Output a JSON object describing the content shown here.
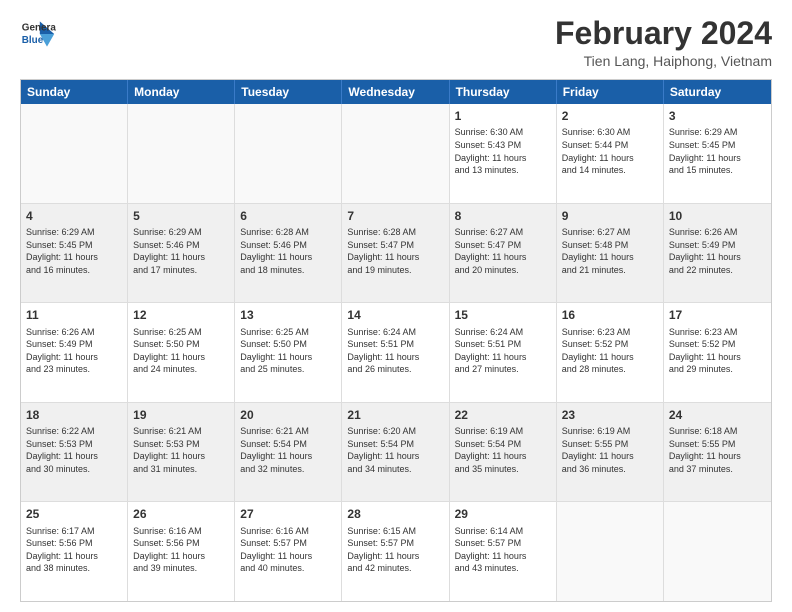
{
  "header": {
    "logo_line1": "General",
    "logo_line2": "Blue",
    "main_title": "February 2024",
    "subtitle": "Tien Lang, Haiphong, Vietnam"
  },
  "calendar": {
    "days": [
      "Sunday",
      "Monday",
      "Tuesday",
      "Wednesday",
      "Thursday",
      "Friday",
      "Saturday"
    ],
    "rows": [
      [
        {
          "day": "",
          "info": ""
        },
        {
          "day": "",
          "info": ""
        },
        {
          "day": "",
          "info": ""
        },
        {
          "day": "",
          "info": ""
        },
        {
          "day": "1",
          "info": "Sunrise: 6:30 AM\nSunset: 5:43 PM\nDaylight: 11 hours\nand 13 minutes."
        },
        {
          "day": "2",
          "info": "Sunrise: 6:30 AM\nSunset: 5:44 PM\nDaylight: 11 hours\nand 14 minutes."
        },
        {
          "day": "3",
          "info": "Sunrise: 6:29 AM\nSunset: 5:45 PM\nDaylight: 11 hours\nand 15 minutes."
        }
      ],
      [
        {
          "day": "4",
          "info": "Sunrise: 6:29 AM\nSunset: 5:45 PM\nDaylight: 11 hours\nand 16 minutes."
        },
        {
          "day": "5",
          "info": "Sunrise: 6:29 AM\nSunset: 5:46 PM\nDaylight: 11 hours\nand 17 minutes."
        },
        {
          "day": "6",
          "info": "Sunrise: 6:28 AM\nSunset: 5:46 PM\nDaylight: 11 hours\nand 18 minutes."
        },
        {
          "day": "7",
          "info": "Sunrise: 6:28 AM\nSunset: 5:47 PM\nDaylight: 11 hours\nand 19 minutes."
        },
        {
          "day": "8",
          "info": "Sunrise: 6:27 AM\nSunset: 5:47 PM\nDaylight: 11 hours\nand 20 minutes."
        },
        {
          "day": "9",
          "info": "Sunrise: 6:27 AM\nSunset: 5:48 PM\nDaylight: 11 hours\nand 21 minutes."
        },
        {
          "day": "10",
          "info": "Sunrise: 6:26 AM\nSunset: 5:49 PM\nDaylight: 11 hours\nand 22 minutes."
        }
      ],
      [
        {
          "day": "11",
          "info": "Sunrise: 6:26 AM\nSunset: 5:49 PM\nDaylight: 11 hours\nand 23 minutes."
        },
        {
          "day": "12",
          "info": "Sunrise: 6:25 AM\nSunset: 5:50 PM\nDaylight: 11 hours\nand 24 minutes."
        },
        {
          "day": "13",
          "info": "Sunrise: 6:25 AM\nSunset: 5:50 PM\nDaylight: 11 hours\nand 25 minutes."
        },
        {
          "day": "14",
          "info": "Sunrise: 6:24 AM\nSunset: 5:51 PM\nDaylight: 11 hours\nand 26 minutes."
        },
        {
          "day": "15",
          "info": "Sunrise: 6:24 AM\nSunset: 5:51 PM\nDaylight: 11 hours\nand 27 minutes."
        },
        {
          "day": "16",
          "info": "Sunrise: 6:23 AM\nSunset: 5:52 PM\nDaylight: 11 hours\nand 28 minutes."
        },
        {
          "day": "17",
          "info": "Sunrise: 6:23 AM\nSunset: 5:52 PM\nDaylight: 11 hours\nand 29 minutes."
        }
      ],
      [
        {
          "day": "18",
          "info": "Sunrise: 6:22 AM\nSunset: 5:53 PM\nDaylight: 11 hours\nand 30 minutes."
        },
        {
          "day": "19",
          "info": "Sunrise: 6:21 AM\nSunset: 5:53 PM\nDaylight: 11 hours\nand 31 minutes."
        },
        {
          "day": "20",
          "info": "Sunrise: 6:21 AM\nSunset: 5:54 PM\nDaylight: 11 hours\nand 32 minutes."
        },
        {
          "day": "21",
          "info": "Sunrise: 6:20 AM\nSunset: 5:54 PM\nDaylight: 11 hours\nand 34 minutes."
        },
        {
          "day": "22",
          "info": "Sunrise: 6:19 AM\nSunset: 5:54 PM\nDaylight: 11 hours\nand 35 minutes."
        },
        {
          "day": "23",
          "info": "Sunrise: 6:19 AM\nSunset: 5:55 PM\nDaylight: 11 hours\nand 36 minutes."
        },
        {
          "day": "24",
          "info": "Sunrise: 6:18 AM\nSunset: 5:55 PM\nDaylight: 11 hours\nand 37 minutes."
        }
      ],
      [
        {
          "day": "25",
          "info": "Sunrise: 6:17 AM\nSunset: 5:56 PM\nDaylight: 11 hours\nand 38 minutes."
        },
        {
          "day": "26",
          "info": "Sunrise: 6:16 AM\nSunset: 5:56 PM\nDaylight: 11 hours\nand 39 minutes."
        },
        {
          "day": "27",
          "info": "Sunrise: 6:16 AM\nSunset: 5:57 PM\nDaylight: 11 hours\nand 40 minutes."
        },
        {
          "day": "28",
          "info": "Sunrise: 6:15 AM\nSunset: 5:57 PM\nDaylight: 11 hours\nand 42 minutes."
        },
        {
          "day": "29",
          "info": "Sunrise: 6:14 AM\nSunset: 5:57 PM\nDaylight: 11 hours\nand 43 minutes."
        },
        {
          "day": "",
          "info": ""
        },
        {
          "day": "",
          "info": ""
        }
      ]
    ]
  }
}
